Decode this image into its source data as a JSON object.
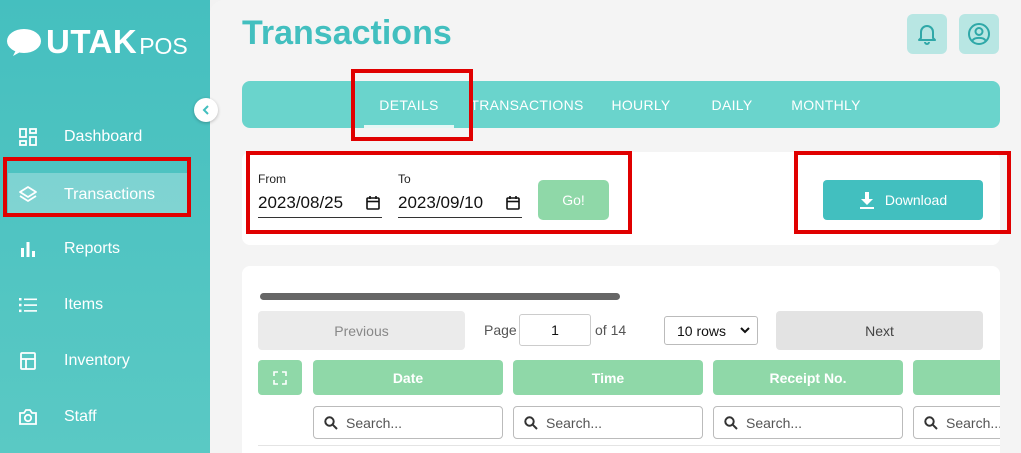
{
  "app": {
    "logo_word": "UTAK",
    "logo_suffix": "POS"
  },
  "sidebar": {
    "items": [
      {
        "label": "Dashboard",
        "icon": "dashboard-icon"
      },
      {
        "label": "Transactions",
        "icon": "layers-icon",
        "active": true
      },
      {
        "label": "Reports",
        "icon": "bar-chart-icon"
      },
      {
        "label": "Items",
        "icon": "list-icon"
      },
      {
        "label": "Inventory",
        "icon": "inventory-icon"
      },
      {
        "label": "Staff",
        "icon": "camera-icon"
      }
    ]
  },
  "header": {
    "title": "Transactions"
  },
  "tabs": [
    {
      "label": "DETAILS",
      "active": true
    },
    {
      "label": "TRANSACTIONS"
    },
    {
      "label": "HOURLY"
    },
    {
      "label": "DAILY"
    },
    {
      "label": "MONTHLY"
    }
  ],
  "filters": {
    "from_label": "From",
    "from_value": "2023/08/25",
    "to_label": "To",
    "to_value": "2023/09/10",
    "go_label": "Go!",
    "download_label": "Download"
  },
  "pagination": {
    "previous_label": "Previous",
    "page_label": "Page",
    "page_value": "1",
    "of_label": "of 14",
    "rows_option": "10 rows",
    "next_label": "Next"
  },
  "table": {
    "columns": [
      "Date",
      "Time",
      "Receipt No.",
      ""
    ],
    "search_placeholders": [
      "Search...",
      "Search...",
      "Search...",
      "Search..."
    ]
  },
  "colors": {
    "brand_teal": "#42bfbf",
    "tab_bar": "#6ad4cc",
    "header_green": "#8fd8a8",
    "highlight_red": "#e00000"
  }
}
